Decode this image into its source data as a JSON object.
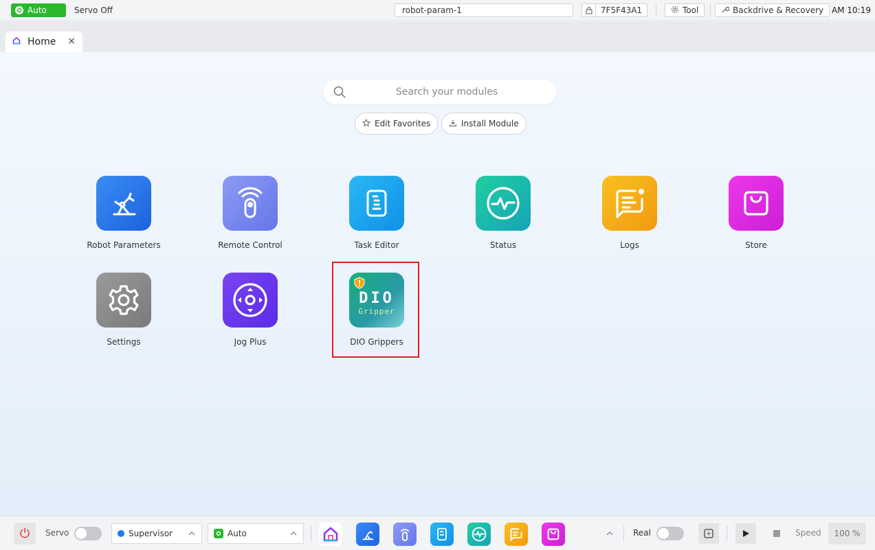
{
  "topbar": {
    "mode": "Auto",
    "servo_state": "Servo Off",
    "robot_name": "robot-param-1",
    "serial": "7F5F43A1",
    "tool_label": "Tool",
    "backdrive_label": "Backdrive & Recovery",
    "clock": "AM 10:19"
  },
  "tab": {
    "label": "Home",
    "close": "×"
  },
  "search": {
    "placeholder": "Search your modules"
  },
  "actions": {
    "edit_favorites": "Edit Favorites",
    "install_module": "Install Module"
  },
  "apps": [
    {
      "label": "Robot Parameters",
      "color": "#2f7ff0"
    },
    {
      "label": "Remote Control",
      "color": "#7b8cf0"
    },
    {
      "label": "Task Editor",
      "color": "#1fa6ef"
    },
    {
      "label": "Status",
      "color": "#1bb8a0"
    },
    {
      "label": "Logs",
      "color": "#f5b117"
    },
    {
      "label": "Store",
      "color": "#e22ee0"
    },
    {
      "label": "Settings",
      "color": "#8a8a8a"
    },
    {
      "label": "Jog Plus",
      "color": "#6b38ee"
    },
    {
      "label": "DIO Grippers",
      "color": "#1fae84",
      "icon_text_1": "DIO",
      "icon_text_2": "Gripper"
    }
  ],
  "taskbar": {
    "servo_label": "Servo",
    "role": "Supervisor",
    "mode": "Auto",
    "real_label": "Real",
    "speed_label": "Speed",
    "speed_value": "100 %"
  },
  "colors": {
    "accent_green": "#2cb82c",
    "highlight_red": "#e01e1e"
  }
}
